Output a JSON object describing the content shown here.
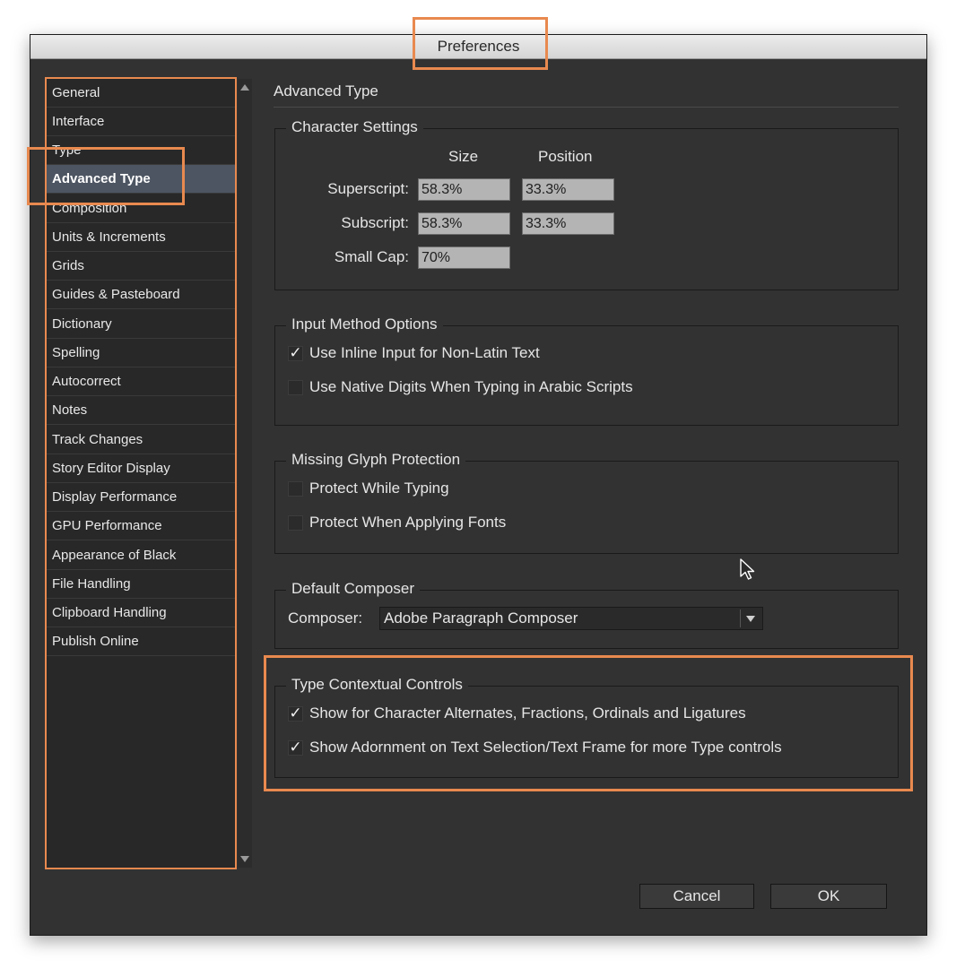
{
  "window": {
    "title": "Preferences"
  },
  "sidebar": {
    "items": [
      {
        "label": "General"
      },
      {
        "label": "Interface"
      },
      {
        "label": "Type"
      },
      {
        "label": "Advanced Type",
        "selected": true
      },
      {
        "label": "Composition"
      },
      {
        "label": "Units & Increments"
      },
      {
        "label": "Grids"
      },
      {
        "label": "Guides & Pasteboard"
      },
      {
        "label": "Dictionary"
      },
      {
        "label": "Spelling"
      },
      {
        "label": "Autocorrect"
      },
      {
        "label": "Notes"
      },
      {
        "label": "Track Changes"
      },
      {
        "label": "Story Editor Display"
      },
      {
        "label": "Display Performance"
      },
      {
        "label": "GPU Performance"
      },
      {
        "label": "Appearance of Black"
      },
      {
        "label": "File Handling"
      },
      {
        "label": "Clipboard Handling"
      },
      {
        "label": "Publish Online"
      }
    ]
  },
  "main": {
    "section_title": "Advanced Type",
    "character_settings": {
      "legend": "Character Settings",
      "size_header": "Size",
      "position_header": "Position",
      "superscript_label": "Superscript:",
      "superscript_size": "58.3%",
      "superscript_position": "33.3%",
      "subscript_label": "Subscript:",
      "subscript_size": "58.3%",
      "subscript_position": "33.3%",
      "small_cap_label": "Small Cap:",
      "small_cap_value": "70%"
    },
    "input_method": {
      "legend": "Input Method Options",
      "inline_input_label": "Use Inline Input for Non-Latin Text",
      "inline_input_checked": true,
      "native_digits_label": "Use Native Digits When Typing in Arabic Scripts",
      "native_digits_checked": false
    },
    "missing_glyph": {
      "legend": "Missing Glyph Protection",
      "typing_label": "Protect While Typing",
      "typing_checked": false,
      "fonts_label": "Protect When Applying Fonts",
      "fonts_checked": false
    },
    "default_composer": {
      "legend": "Default Composer",
      "composer_label": "Composer:",
      "composer_value": "Adobe Paragraph Composer"
    },
    "type_contextual": {
      "legend": "Type Contextual Controls",
      "alternates_label": "Show for Character Alternates, Fractions, Ordinals and Ligatures",
      "alternates_checked": true,
      "adornment_label": "Show Adornment on Text Selection/Text Frame for more Type controls",
      "adornment_checked": true
    }
  },
  "footer": {
    "cancel_label": "Cancel",
    "ok_label": "OK"
  },
  "colors": {
    "highlight": "#e8894f",
    "window_bg": "#323232",
    "selected_bg": "#4d5562"
  }
}
